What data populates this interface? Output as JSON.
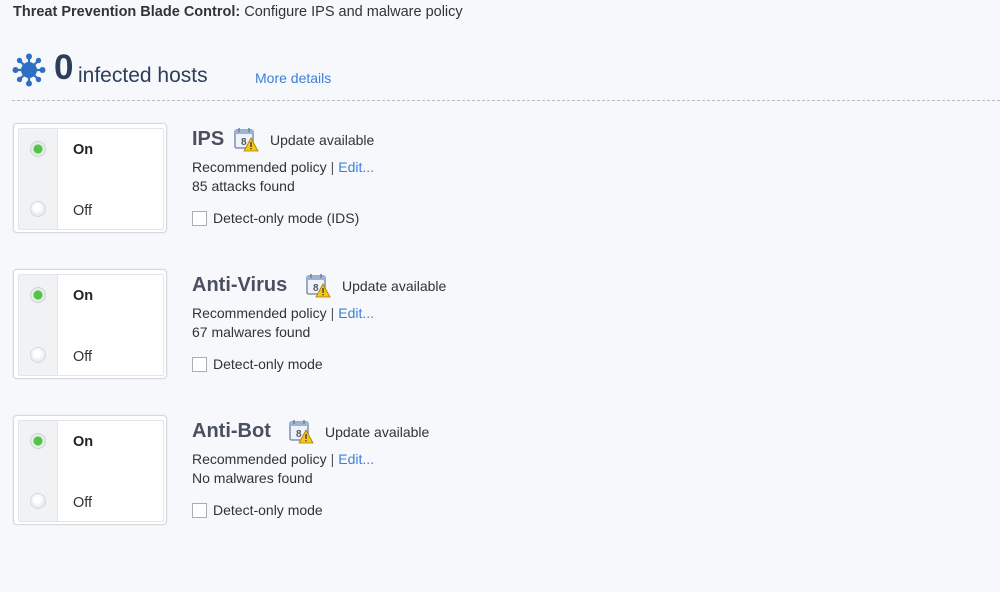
{
  "header": {
    "title_bold": "Threat Prevention Blade Control:",
    "title_rest": "Configure IPS and malware policy"
  },
  "summary": {
    "icon": "virus-icon",
    "count": "0",
    "label": "infected hosts",
    "more_details": "More details"
  },
  "blades": [
    {
      "name": "IPS",
      "state": "On",
      "on_label": "On",
      "off_label": "Off",
      "update_icon": "calendar-warning-icon",
      "update_text": "Update available",
      "policy": "Recommended policy",
      "separator": "|",
      "edit": "Edit...",
      "found": "85 attacks found",
      "detect_label": "Detect-only mode (IDS)",
      "detect_checked": false
    },
    {
      "name": "Anti-Virus",
      "state": "On",
      "on_label": "On",
      "off_label": "Off",
      "update_icon": "calendar-warning-icon",
      "update_text": "Update available",
      "policy": "Recommended policy",
      "separator": "|",
      "edit": "Edit...",
      "found": "67 malwares found",
      "detect_label": "Detect-only mode",
      "detect_checked": false
    },
    {
      "name": "Anti-Bot",
      "state": "On",
      "on_label": "On",
      "off_label": "Off",
      "update_icon": "calendar-warning-icon",
      "update_text": "Update available",
      "policy": "Recommended policy",
      "separator": "|",
      "edit": "Edit...",
      "found": "No malwares found",
      "detect_label": "Detect-only mode",
      "detect_checked": false
    }
  ],
  "colors": {
    "link": "#3d7fd6",
    "accent_dark": "#2c3e5a",
    "radio_on": "#4fc34a",
    "background": "#f6f8fc"
  }
}
